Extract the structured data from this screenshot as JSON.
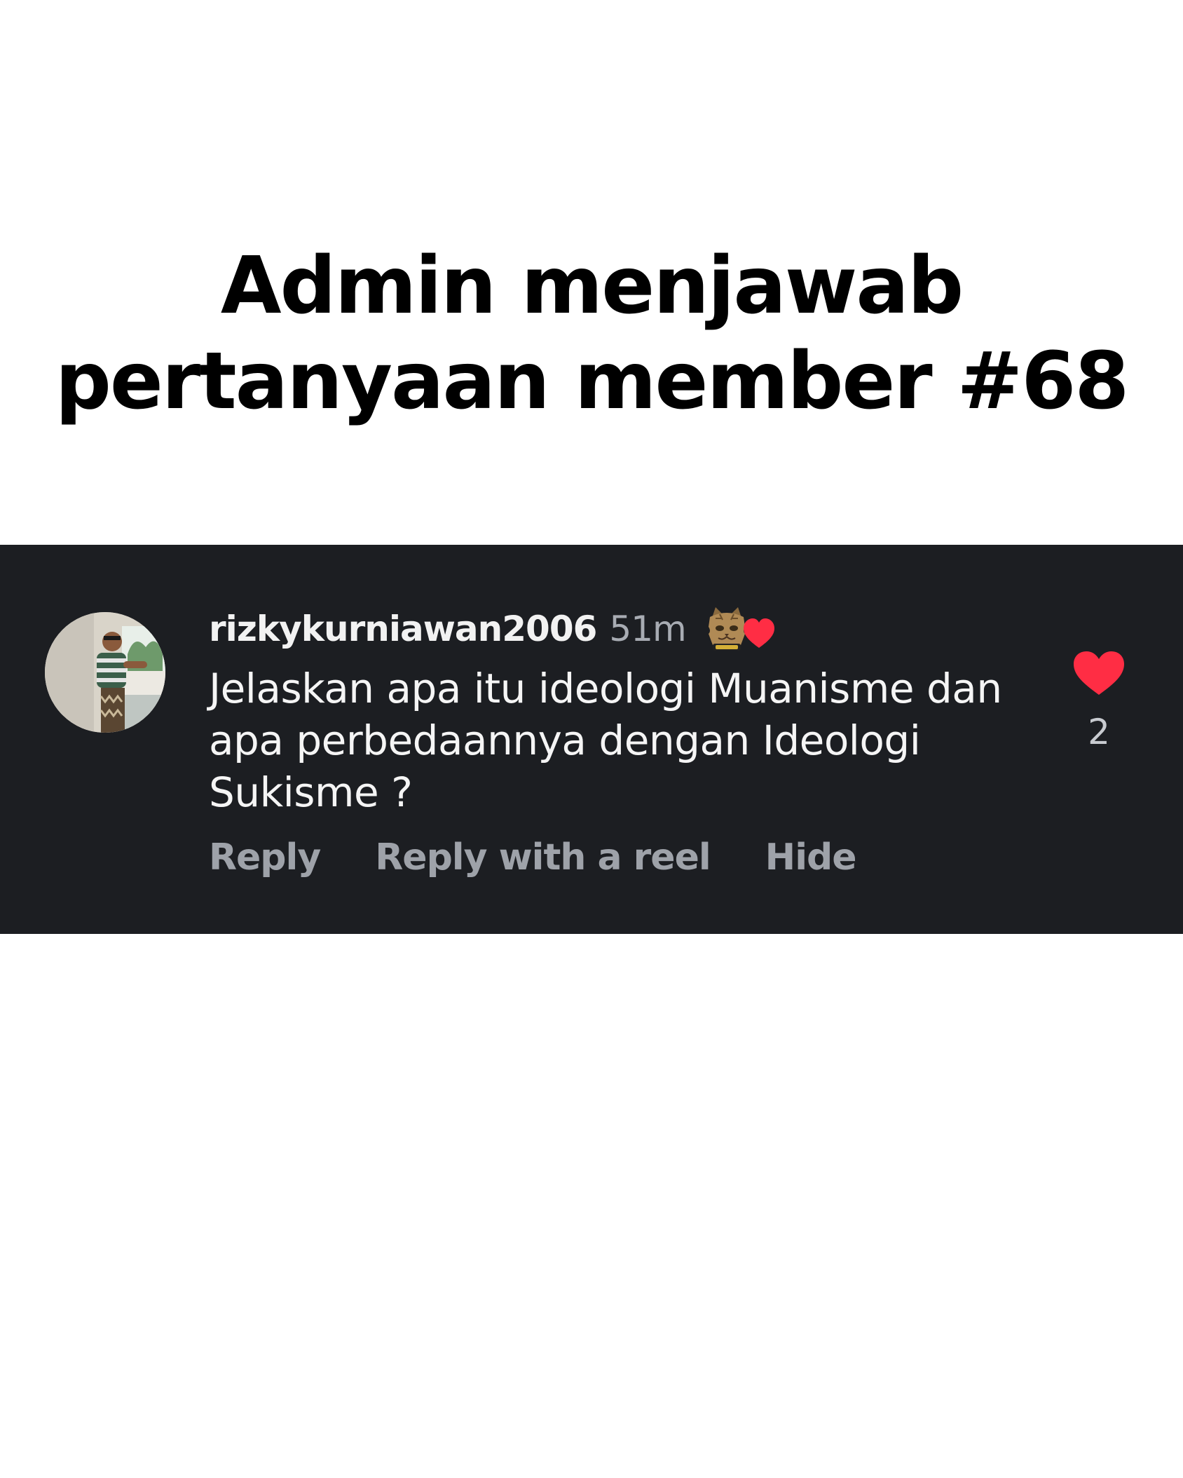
{
  "headline": {
    "line1": "Admin menjawab",
    "line2": "pertanyaan member #68"
  },
  "comment": {
    "username": "rizkykurniawan2006",
    "timestamp": "51m",
    "text": "Jelaskan apa itu ideologi Muanisme dan apa perbedaannya dengan Ideologi Sukisme ?",
    "like_count": "2",
    "actions": {
      "reply": "Reply",
      "reply_with_reel": "Reply with a reel",
      "hide": "Hide"
    },
    "badge_icon": "cat-with-heart-icon",
    "like_icon": "heart-icon",
    "colors": {
      "card_bg": "#1c1e22",
      "heart": "#ff2d44",
      "action_text": "#9ea2a9"
    }
  }
}
